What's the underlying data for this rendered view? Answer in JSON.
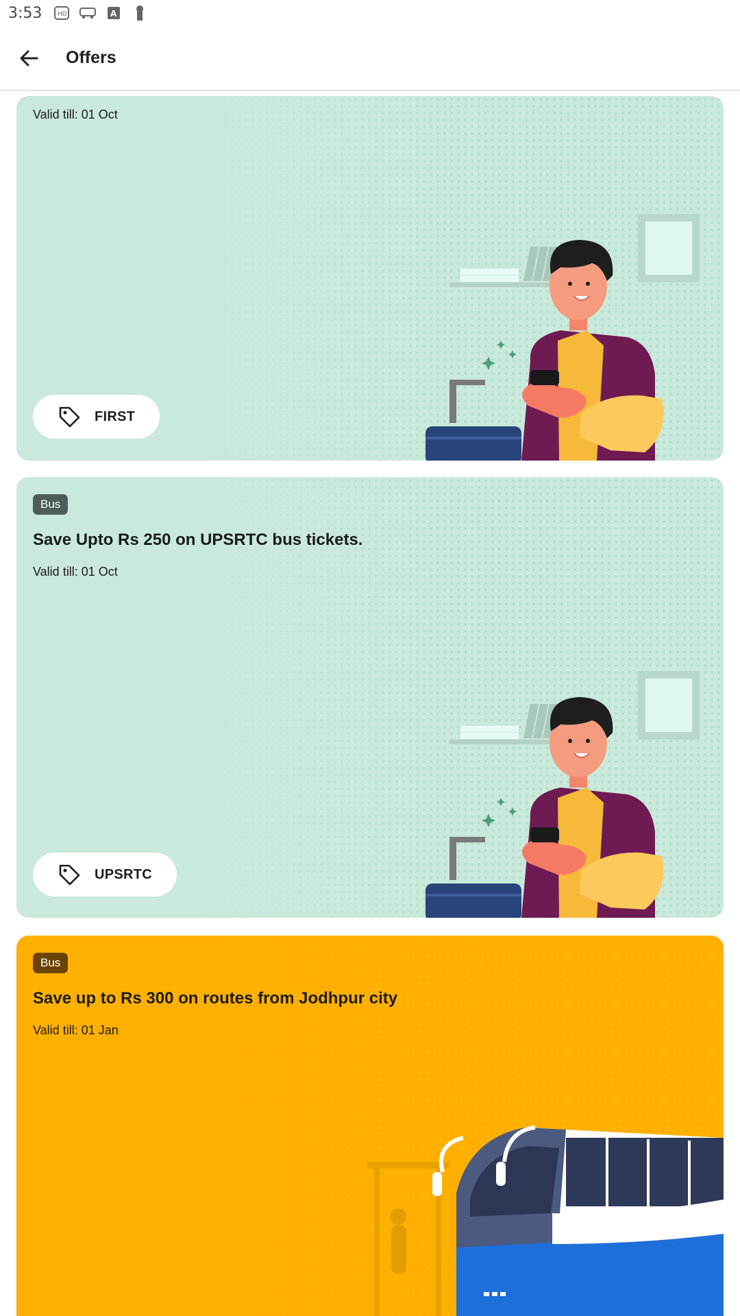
{
  "status_bar": {
    "time": "3:53",
    "icons": [
      "media-icon",
      "bus-icon",
      "font-icon",
      "key-icon"
    ]
  },
  "app_bar": {
    "title": "Offers",
    "back_icon": "arrow-left-icon"
  },
  "offers": [
    {
      "category": "",
      "title": "",
      "valid": "Valid till: 01 Oct",
      "code": "FIRST",
      "theme": "#c9e9da",
      "illustration": "man-with-phone-and-suitcase"
    },
    {
      "category": "Bus",
      "title": "Save Upto Rs 250 on UPSRTC bus tickets.",
      "valid": "Valid till: 01 Oct",
      "code": "UPSRTC",
      "theme": "#c9e9da",
      "illustration": "man-with-phone-and-suitcase"
    },
    {
      "category": "Bus",
      "title": "Save up to Rs 300 on routes from Jodhpur city",
      "valid": "Valid till: 01 Jan",
      "code": "",
      "theme": "#ffb000",
      "illustration": "blue-white-bus"
    }
  ],
  "colors": {
    "card_green": "#c9e9da",
    "card_yellow": "#ffb000",
    "badge_green": "#4d5d57",
    "badge_brown": "#6b4300"
  }
}
